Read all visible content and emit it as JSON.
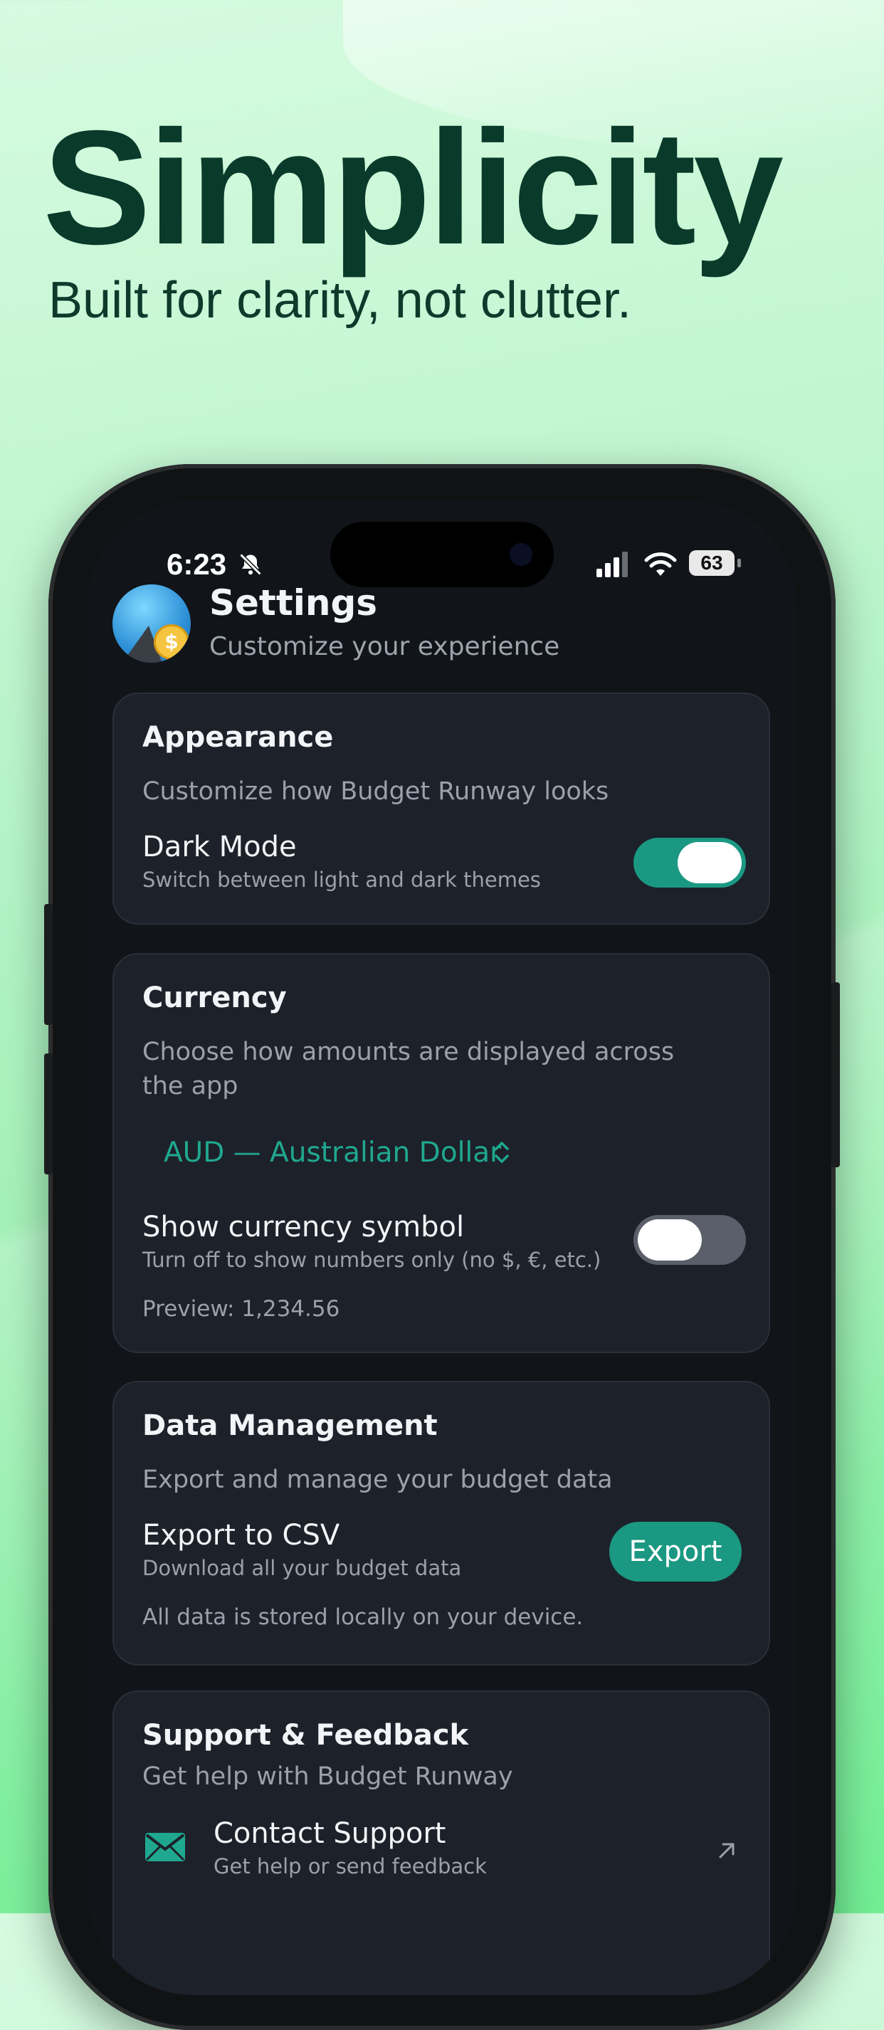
{
  "hero": {
    "headline": "Simplicity",
    "tagline": "Built for clarity, not clutter."
  },
  "statusbar": {
    "time": "6:23",
    "battery": "63"
  },
  "settings": {
    "title": "Settings",
    "subtitle": "Customize your experience"
  },
  "appearance": {
    "title": "Appearance",
    "description": "Customize how Budget Runway looks",
    "dark_mode_label": "Dark Mode",
    "dark_mode_sub": "Switch between light and dark themes",
    "dark_mode_on": true
  },
  "currency": {
    "title": "Currency",
    "description_line1": "Choose how amounts are displayed across",
    "description_line2": "the app",
    "selected": "AUD — Australian Dollar",
    "show_symbol_label": "Show currency symbol",
    "show_symbol_sub": "Turn off to show numbers only (no $, €, etc.)",
    "show_symbol_on": false,
    "preview": "Preview: 1,234.56"
  },
  "data_management": {
    "title": "Data Management",
    "description": "Export and manage your budget data",
    "export_label": "Export to CSV",
    "export_sub": "Download all your budget data",
    "export_button": "Export",
    "note": "All data is stored locally on your device."
  },
  "support": {
    "title": "Support & Feedback",
    "description": "Get help with Budget Runway",
    "contact_label": "Contact Support",
    "contact_sub": "Get help or send feedback"
  },
  "colors": {
    "accent": "#1a9882",
    "card_bg": "#1d212a",
    "screen_bg": "#111419",
    "headline": "#0a3a2a"
  },
  "icons": [
    "bell-slash-icon",
    "signal-icon",
    "wifi-icon",
    "battery-icon",
    "app-logo-icon",
    "chevron-up-down-icon",
    "mail-icon",
    "external-arrow-icon"
  ]
}
